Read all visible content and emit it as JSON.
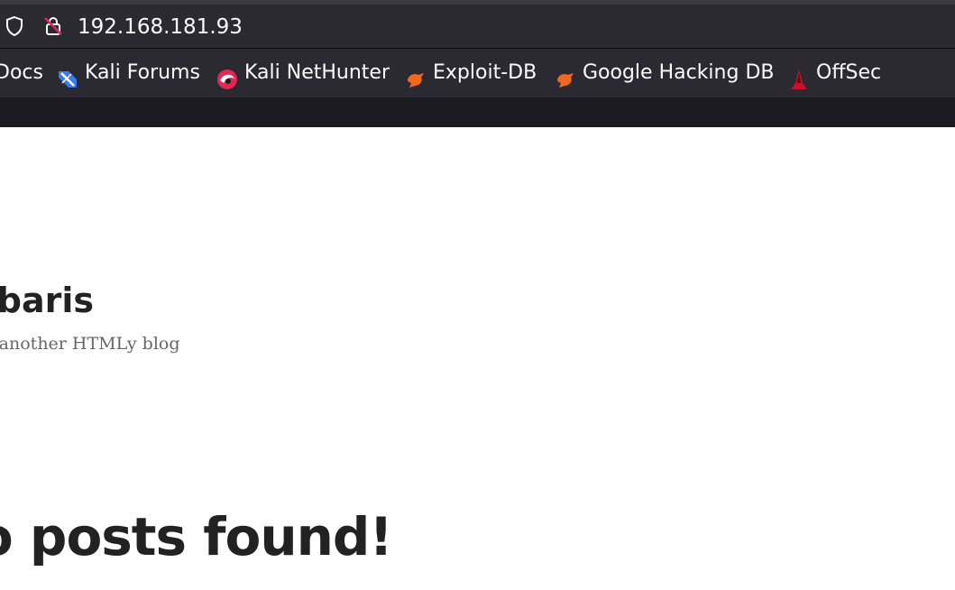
{
  "browser": {
    "url": "192.168.181.93",
    "bookmarks": [
      {
        "label": "Docs",
        "icon": "kali-docs-icon"
      },
      {
        "label": "Kali Forums",
        "icon": "kali-forums-icon"
      },
      {
        "label": "Kali NetHunter",
        "icon": "kali-nethunter-icon"
      },
      {
        "label": "Exploit-DB",
        "icon": "exploit-db-icon"
      },
      {
        "label": "Google Hacking DB",
        "icon": "google-hacking-db-icon"
      },
      {
        "label": "OffSec",
        "icon": "offsec-icon"
      }
    ]
  },
  "page": {
    "site_title": "ybaris",
    "tagline": "t another HTMLy blog",
    "message": "lo posts found!"
  },
  "colors": {
    "chrome_dark": "#1c1b22",
    "chrome_bar": "#2b2a33",
    "text_light": "#fbfbfe",
    "heading": "#222222",
    "tagline": "#666666"
  }
}
